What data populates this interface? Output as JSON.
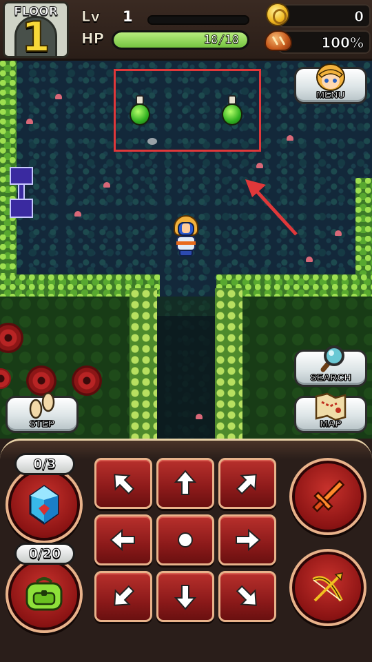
{
  "hud": {
    "floor_label": "FLOOR",
    "floor_number": "1",
    "level_label": "Lv",
    "level_value": "1",
    "hp_label": "HP",
    "hp_current": 18,
    "hp_max": 18,
    "hp_text": "18/18",
    "hp_fraction": 1.0,
    "gold_value": "0",
    "food_value": "100%"
  },
  "buttons": {
    "menu_label": "MENU",
    "search_label": "SEARCH",
    "map_label": "MAP",
    "step_label": "STEP"
  },
  "inventory": {
    "crystal_count": "0/3",
    "bag_count": "0/20"
  },
  "dpad": [
    {
      "dir": "up-left",
      "icon": "arrow-up-left-icon"
    },
    {
      "dir": "up",
      "icon": "arrow-up-icon"
    },
    {
      "dir": "up-right",
      "icon": "arrow-up-right-icon"
    },
    {
      "dir": "left",
      "icon": "arrow-left-icon"
    },
    {
      "dir": "wait",
      "icon": "dot-icon"
    },
    {
      "dir": "right",
      "icon": "arrow-right-icon"
    },
    {
      "dir": "down-left",
      "icon": "arrow-down-left-icon"
    },
    {
      "dir": "down",
      "icon": "arrow-down-icon"
    },
    {
      "dir": "down-right",
      "icon": "arrow-down-right-icon"
    }
  ],
  "colors": {
    "highlight": "#e0383a",
    "hp_fill": "#8ed45a",
    "button_red": "#8c1a1a",
    "potion_green": "#30b020"
  }
}
